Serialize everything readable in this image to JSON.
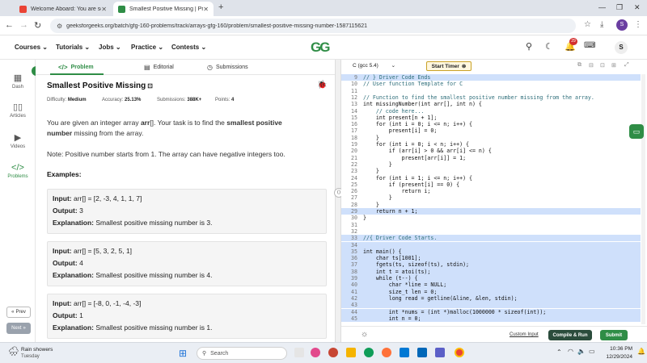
{
  "browser": {
    "tabs": [
      {
        "title": "Welcome Aboard: You are sele",
        "favicon_color": "#ea4335"
      },
      {
        "title": "Smallest Positive Missing | Prac",
        "favicon_color": "#2f8d46"
      }
    ],
    "url": "geeksforgeeks.org/batch/gfg-160-problems/track/arrays-gfg-160/problem/smallest-positive-missing-number-1587115621",
    "profile_letter": "S",
    "notif_count": "29"
  },
  "site": {
    "logo": "GG",
    "nav": [
      "Courses",
      "Tutorials",
      "Jobs",
      "Practice",
      "Contests"
    ],
    "avatar_letter": "S"
  },
  "rail": {
    "items": [
      "Dash",
      "Articles",
      "Videos",
      "Problems"
    ],
    "prev": "Prev",
    "next": "Next"
  },
  "problem": {
    "tabs": [
      "Problem",
      "Editorial",
      "Submissions"
    ],
    "title": "Smallest Positive Missing",
    "meta": {
      "difficulty_label": "Difficulty:",
      "difficulty": "Medium",
      "accuracy_label": "Accuracy:",
      "accuracy": "25.13%",
      "submissions_label": "Submissions:",
      "submissions": "388K+",
      "points_label": "Points:",
      "points": "4"
    },
    "desc_1": "You are given an integer array ",
    "desc_arr": "arr",
    "desc_2": "[]. Your task is to find the ",
    "desc_bold": "smallest positive number",
    "desc_3": " missing from the array.",
    "note": "Note: Positive number starts from 1. The array can have negative integers too.",
    "examples_label": "Examples:",
    "input_label": "Input:",
    "output_label": "Output:",
    "explanation_label": "Explanation:",
    "examples": [
      {
        "input": "arr[] = [2, -3, 4, 1, 1, 7]",
        "output": "3",
        "explanation": "Smallest  positive  missing  number  is  3."
      },
      {
        "input": "arr[] = [5, 3, 2, 5, 1]",
        "output": "4",
        "explanation": "Smallest  positive  missing  number  is  4."
      },
      {
        "input": "arr[] = [-8, 0, -1, -4, -3]",
        "output": "1",
        "explanation": "Smallest  positive  missing  number  is  1."
      }
    ]
  },
  "editor": {
    "language": "C (gcc 5.4)",
    "timer_label": "Start Timer",
    "custom_input": "Custom Input",
    "compile_run": "Compile & Run",
    "submit": "Submit",
    "lines": [
      {
        "n": "9",
        "t": "// } Driver Code Ends",
        "hl": true,
        "c": true
      },
      {
        "n": "10",
        "t": "// User function Template for C",
        "hl": false,
        "c": true
      },
      {
        "n": "11",
        "t": "",
        "hl": false,
        "c": false
      },
      {
        "n": "12",
        "t": "// Function to find the smallest positive number missing from the array.",
        "hl": false,
        "c": true
      },
      {
        "n": "13",
        "t": "int missingNumber(int arr[], int n) {",
        "hl": false,
        "c": false
      },
      {
        "n": "14",
        "t": "    // code here...",
        "hl": false,
        "c": true
      },
      {
        "n": "15",
        "t": "    int present[n + 1];",
        "hl": false,
        "c": false
      },
      {
        "n": "16",
        "t": "    for (int i = 0; i <= n; i++) {",
        "hl": false,
        "c": false
      },
      {
        "n": "17",
        "t": "        present[i] = 0;",
        "hl": false,
        "c": false
      },
      {
        "n": "18",
        "t": "    }",
        "hl": false,
        "c": false
      },
      {
        "n": "19",
        "t": "    for (int i = 0; i < n; i++) {",
        "hl": false,
        "c": false
      },
      {
        "n": "20",
        "t": "        if (arr[i] > 0 && arr[i] <= n) {",
        "hl": false,
        "c": false
      },
      {
        "n": "21",
        "t": "            present[arr[i]] = 1;",
        "hl": false,
        "c": false
      },
      {
        "n": "22",
        "t": "        }",
        "hl": false,
        "c": false
      },
      {
        "n": "23",
        "t": "    }",
        "hl": false,
        "c": false
      },
      {
        "n": "24",
        "t": "    for (int i = 1; i <= n; i++) {",
        "hl": false,
        "c": false
      },
      {
        "n": "25",
        "t": "        if (present[i] == 0) {",
        "hl": false,
        "c": false
      },
      {
        "n": "26",
        "t": "            return i;",
        "hl": false,
        "c": false
      },
      {
        "n": "27",
        "t": "        }",
        "hl": false,
        "c": false
      },
      {
        "n": "28",
        "t": "    }",
        "hl": false,
        "c": false
      },
      {
        "n": "29",
        "t": "    return n + 1;",
        "hl": true,
        "c": false
      },
      {
        "n": "30",
        "t": "}",
        "hl": false,
        "c": false
      },
      {
        "n": "31",
        "t": "",
        "hl": false,
        "c": false
      },
      {
        "n": "32",
        "t": "",
        "hl": false,
        "c": false
      },
      {
        "n": "33",
        "t": "//{ Driver Code Starts.",
        "hl": true,
        "c": true
      },
      {
        "n": "34",
        "t": "",
        "hl": true,
        "c": false
      },
      {
        "n": "35",
        "t": "int main() {",
        "hl": true,
        "c": false
      },
      {
        "n": "36",
        "t": "    char ts[1001];",
        "hl": true,
        "c": false
      },
      {
        "n": "37",
        "t": "    fgets(ts, sizeof(ts), stdin);",
        "hl": true,
        "c": false
      },
      {
        "n": "38",
        "t": "    int t = atoi(ts);",
        "hl": true,
        "c": false
      },
      {
        "n": "39",
        "t": "    while (t--) {",
        "hl": true,
        "c": false
      },
      {
        "n": "40",
        "t": "        char *line = NULL;",
        "hl": true,
        "c": false
      },
      {
        "n": "41",
        "t": "        size_t len = 0;",
        "hl": true,
        "c": false
      },
      {
        "n": "42",
        "t": "        long read = getline(&line, &len, stdin);",
        "hl": true,
        "c": false
      },
      {
        "n": "43",
        "t": "",
        "hl": true,
        "c": false
      },
      {
        "n": "44",
        "t": "        int *nums = (int *)malloc(1000000 * sizeof(int));",
        "hl": true,
        "c": false
      },
      {
        "n": "45",
        "t": "        int n = 0;",
        "hl": true,
        "c": false
      }
    ]
  },
  "taskbar": {
    "weather": "Rain showers",
    "weather_day": "Tuesday",
    "search_placeholder": "Search",
    "time": "10:36 PM",
    "date": "12/29/2024"
  },
  "colors": {
    "gfg_green": "#2f8d46",
    "highlight": "#cfe0fb",
    "submit_green": "#2f8d46",
    "compile_dark": "#2b4c3c"
  }
}
